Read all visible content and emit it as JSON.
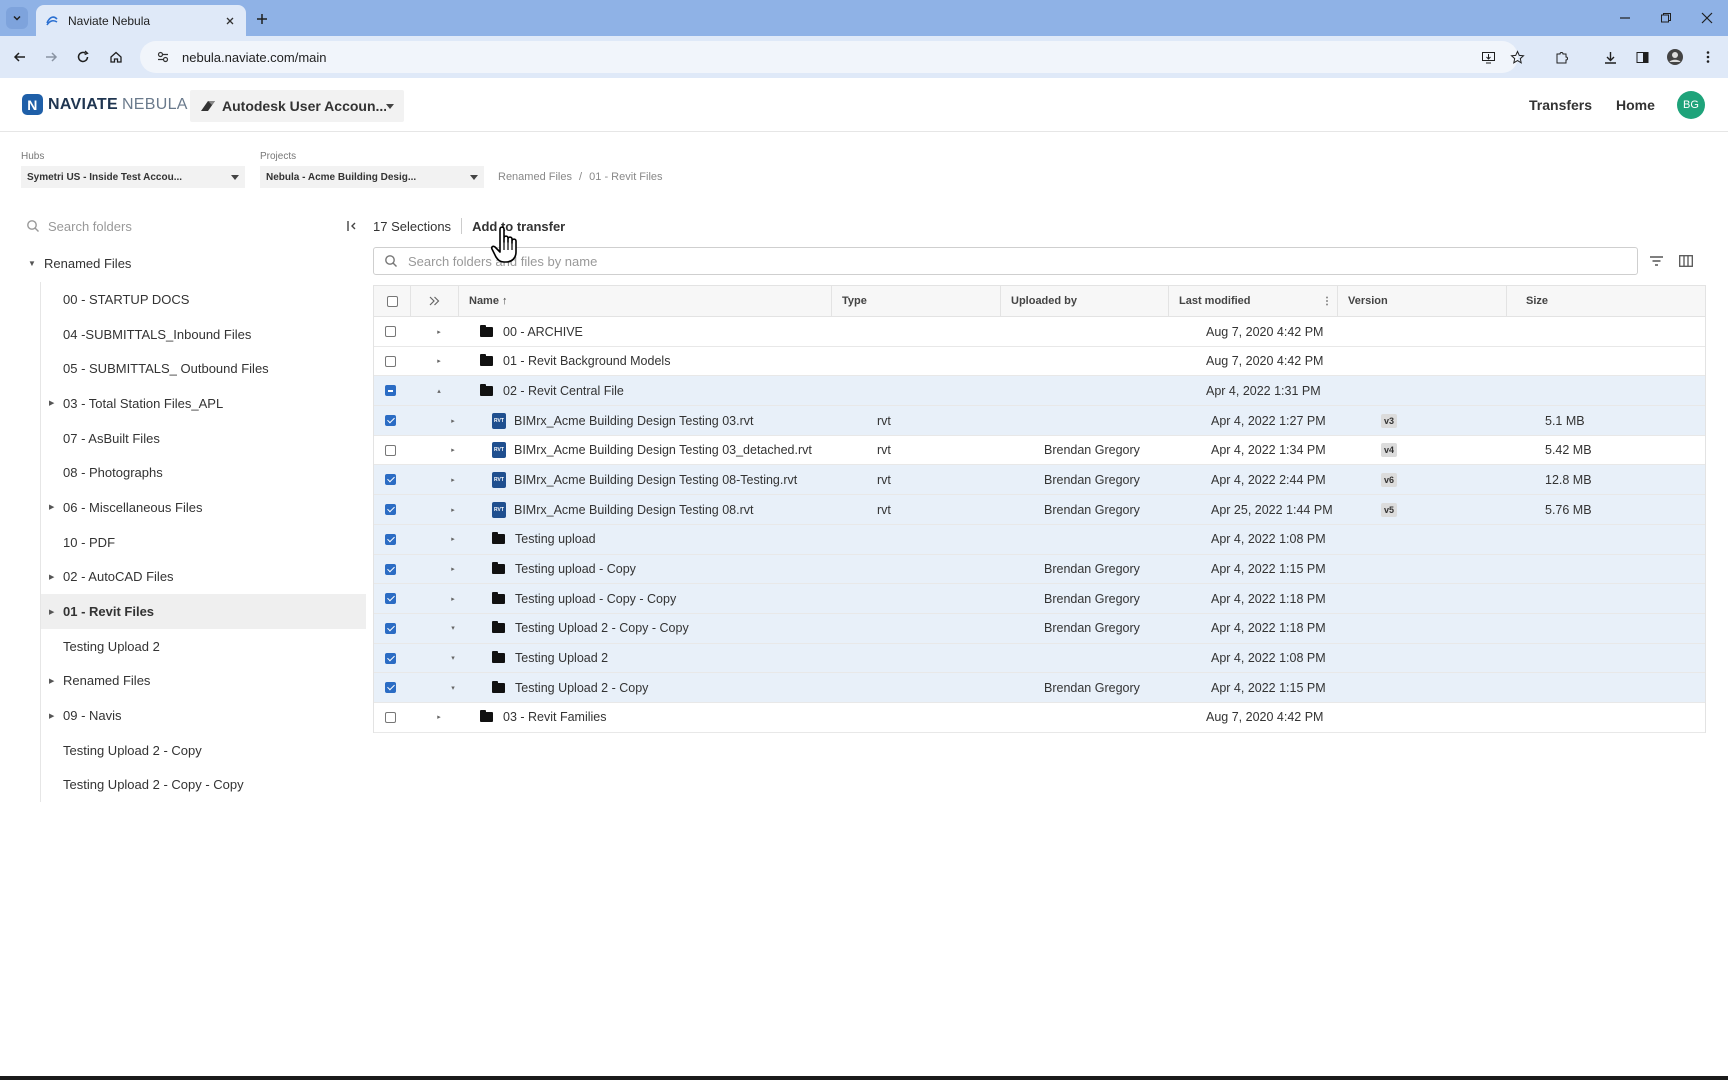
{
  "browser": {
    "tab_title": "Naviate Nebula",
    "url": "nebula.naviate.com/main"
  },
  "header": {
    "logo_naviate": "NAVIATE",
    "logo_nebula": "NEBULA",
    "account": "Autodesk User Accoun...",
    "transfers": "Transfers",
    "home": "Home",
    "avatar": "BG"
  },
  "selectors": {
    "hubs_label": "Hubs",
    "hubs_value": "Symetri US - Inside Test Accou...",
    "projects_label": "Projects",
    "projects_value": "Nebula - Acme Building Desig...",
    "breadcrumb": [
      "Renamed Files",
      "/",
      "01 - Revit Files"
    ]
  },
  "sidebar": {
    "search_placeholder": "Search folders",
    "root": "Renamed Files",
    "items": [
      {
        "label": "00 - STARTUP DOCS",
        "expandable": false
      },
      {
        "label": "04 -SUBMITTALS_Inbound Files",
        "expandable": false
      },
      {
        "label": "05 - SUBMITTALS_ Outbound Files",
        "expandable": false
      },
      {
        "label": "03 - Total Station Files_APL",
        "expandable": true
      },
      {
        "label": "07 - AsBuilt Files",
        "expandable": false
      },
      {
        "label": "08 - Photographs",
        "expandable": false
      },
      {
        "label": "06 - Miscellaneous Files",
        "expandable": true
      },
      {
        "label": "10 - PDF",
        "expandable": false
      },
      {
        "label": "02 - AutoCAD Files",
        "expandable": true
      },
      {
        "label": "01 - Revit Files",
        "expandable": true,
        "active": true
      },
      {
        "label": "Testing Upload 2",
        "expandable": false
      },
      {
        "label": "Renamed Files",
        "expandable": true
      },
      {
        "label": "09 - Navis",
        "expandable": true
      },
      {
        "label": "Testing Upload 2 - Copy",
        "expandable": false
      },
      {
        "label": "Testing Upload 2 - Copy - Copy",
        "expandable": false
      }
    ]
  },
  "main": {
    "selections": "17 Selections",
    "add_to_transfer": "Add to transfer",
    "search_placeholder": "Search folders and files by name",
    "columns": {
      "name": "Name",
      "sort_indicator": "↑",
      "type": "Type",
      "uploaded_by": "Uploaded by",
      "last_modified": "Last modified",
      "version": "Version",
      "size": "Size"
    },
    "rows": [
      {
        "name": "00 - ARCHIVE",
        "kind": "folder",
        "level": 0,
        "toggle": "▸",
        "check": "off",
        "type": "",
        "uploaded_by": "",
        "modified": "Aug 7, 2020 4:42 PM",
        "version": "",
        "size": ""
      },
      {
        "name": "01 - Revit Background Models",
        "kind": "folder",
        "level": 0,
        "toggle": "▸",
        "check": "off",
        "type": "",
        "uploaded_by": "",
        "modified": "Aug 7, 2020 4:42 PM",
        "version": "",
        "size": ""
      },
      {
        "name": "02 - Revit Central File",
        "kind": "folder",
        "level": 0,
        "toggle": "▴",
        "check": "ind",
        "type": "",
        "uploaded_by": "",
        "modified": "Apr 4, 2022 1:31 PM",
        "version": "",
        "size": ""
      },
      {
        "name": "BIMrx_Acme Building Design Testing 03.rvt",
        "kind": "rvt",
        "level": 1,
        "toggle": "▸",
        "check": "on",
        "type": "rvt",
        "uploaded_by": "",
        "modified": "Apr 4, 2022 1:27 PM",
        "version": "v3",
        "size": "5.1 MB"
      },
      {
        "name": "BIMrx_Acme Building Design Testing 03_detached.rvt",
        "kind": "rvt",
        "level": 1,
        "toggle": "▸",
        "check": "off",
        "type": "rvt",
        "uploaded_by": "Brendan Gregory",
        "modified": "Apr 4, 2022 1:34 PM",
        "version": "v4",
        "size": "5.42 MB"
      },
      {
        "name": "BIMrx_Acme Building Design Testing 08-Testing.rvt",
        "kind": "rvt",
        "level": 1,
        "toggle": "▸",
        "check": "on",
        "type": "rvt",
        "uploaded_by": "Brendan Gregory",
        "modified": "Apr 4, 2022 2:44 PM",
        "version": "v6",
        "size": "12.8 MB"
      },
      {
        "name": "BIMrx_Acme Building Design Testing 08.rvt",
        "kind": "rvt",
        "level": 1,
        "toggle": "▸",
        "check": "on",
        "type": "rvt",
        "uploaded_by": "Brendan Gregory",
        "modified": "Apr 25, 2022 1:44 PM",
        "version": "v5",
        "size": "5.76 MB"
      },
      {
        "name": "Testing upload",
        "kind": "folder",
        "level": 1,
        "toggle": "▸",
        "check": "on",
        "type": "",
        "uploaded_by": "",
        "modified": "Apr 4, 2022 1:08 PM",
        "version": "",
        "size": ""
      },
      {
        "name": "Testing upload - Copy",
        "kind": "folder",
        "level": 1,
        "toggle": "▸",
        "check": "on",
        "type": "",
        "uploaded_by": "Brendan Gregory",
        "modified": "Apr 4, 2022 1:15 PM",
        "version": "",
        "size": ""
      },
      {
        "name": "Testing upload - Copy - Copy",
        "kind": "folder",
        "level": 1,
        "toggle": "▸",
        "check": "on",
        "type": "",
        "uploaded_by": "Brendan Gregory",
        "modified": "Apr 4, 2022 1:18 PM",
        "version": "",
        "size": ""
      },
      {
        "name": "Testing Upload 2 - Copy - Copy",
        "kind": "folder",
        "level": 1,
        "toggle": "▾",
        "check": "on",
        "type": "",
        "uploaded_by": "Brendan Gregory",
        "modified": "Apr 4, 2022 1:18 PM",
        "version": "",
        "size": ""
      },
      {
        "name": "Testing Upload 2",
        "kind": "folder",
        "level": 1,
        "toggle": "▾",
        "check": "on",
        "type": "",
        "uploaded_by": "",
        "modified": "Apr 4, 2022 1:08 PM",
        "version": "",
        "size": ""
      },
      {
        "name": "Testing Upload 2 - Copy",
        "kind": "folder",
        "level": 1,
        "toggle": "▾",
        "check": "on",
        "type": "",
        "uploaded_by": "Brendan Gregory",
        "modified": "Apr 4, 2022 1:15 PM",
        "version": "",
        "size": ""
      },
      {
        "name": "03 - Revit Families",
        "kind": "folder",
        "level": 0,
        "toggle": "▸",
        "check": "off",
        "type": "",
        "uploaded_by": "",
        "modified": "Aug 7, 2020 4:42 PM",
        "version": "",
        "size": ""
      }
    ]
  },
  "icons": {
    "rvt_glyph": "RVT"
  },
  "colors": {
    "tabstrip": "#8fb2e6",
    "toolbar": "#dfe9f8",
    "accent": "#2b6cc4",
    "selected_row": "#e8f0f9",
    "avatar": "#1ea37a"
  }
}
